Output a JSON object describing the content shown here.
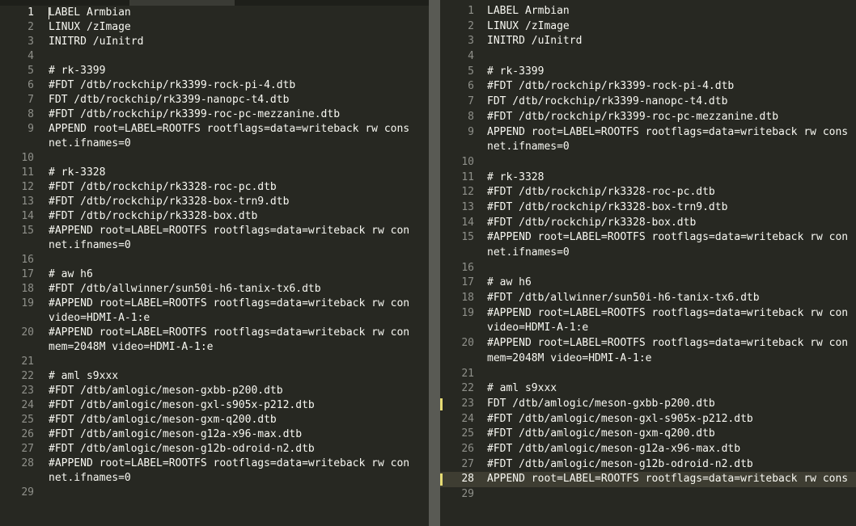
{
  "left_pane": {
    "lines": [
      {
        "num": "1",
        "text": "LABEL Armbian"
      },
      {
        "num": "2",
        "text": "LINUX /zImage"
      },
      {
        "num": "3",
        "text": "INITRD /uInitrd"
      },
      {
        "num": "4",
        "text": ""
      },
      {
        "num": "5",
        "text": "# rk-3399"
      },
      {
        "num": "6",
        "text": "#FDT /dtb/rockchip/rk3399-rock-pi-4.dtb"
      },
      {
        "num": "7",
        "text": "FDT /dtb/rockchip/rk3399-nanopc-t4.dtb"
      },
      {
        "num": "8",
        "text": "#FDT /dtb/rockchip/rk3399-roc-pc-mezzanine.dtb"
      },
      {
        "num": "9",
        "text": "APPEND root=LABEL=ROOTFS rootflags=data=writeback rw cons"
      },
      {
        "num": "",
        "text": "net.ifnames=0"
      },
      {
        "num": "10",
        "text": ""
      },
      {
        "num": "11",
        "text": "# rk-3328"
      },
      {
        "num": "12",
        "text": "#FDT /dtb/rockchip/rk3328-roc-pc.dtb"
      },
      {
        "num": "13",
        "text": "#FDT /dtb/rockchip/rk3328-box-trn9.dtb"
      },
      {
        "num": "14",
        "text": "#FDT /dtb/rockchip/rk3328-box.dtb"
      },
      {
        "num": "15",
        "text": "#APPEND root=LABEL=ROOTFS rootflags=data=writeback rw con"
      },
      {
        "num": "",
        "text": "net.ifnames=0"
      },
      {
        "num": "16",
        "text": ""
      },
      {
        "num": "17",
        "text": "# aw h6"
      },
      {
        "num": "18",
        "text": "#FDT /dtb/allwinner/sun50i-h6-tanix-tx6.dtb"
      },
      {
        "num": "19",
        "text": "#APPEND root=LABEL=ROOTFS rootflags=data=writeback rw con"
      },
      {
        "num": "",
        "text": "video=HDMI-A-1:e"
      },
      {
        "num": "20",
        "text": "#APPEND root=LABEL=ROOTFS rootflags=data=writeback rw con"
      },
      {
        "num": "",
        "text": "mem=2048M video=HDMI-A-1:e"
      },
      {
        "num": "21",
        "text": ""
      },
      {
        "num": "22",
        "text": "# aml s9xxx"
      },
      {
        "num": "23",
        "text": "#FDT /dtb/amlogic/meson-gxbb-p200.dtb"
      },
      {
        "num": "24",
        "text": "#FDT /dtb/amlogic/meson-gxl-s905x-p212.dtb"
      },
      {
        "num": "25",
        "text": "#FDT /dtb/amlogic/meson-gxm-q200.dtb"
      },
      {
        "num": "26",
        "text": "#FDT /dtb/amlogic/meson-g12a-x96-max.dtb"
      },
      {
        "num": "27",
        "text": "#FDT /dtb/amlogic/meson-g12b-odroid-n2.dtb"
      },
      {
        "num": "28",
        "text": "#APPEND root=LABEL=ROOTFS rootflags=data=writeback rw con"
      },
      {
        "num": "",
        "text": "net.ifnames=0"
      },
      {
        "num": "29",
        "text": ""
      }
    ]
  },
  "right_pane": {
    "lines": [
      {
        "num": "1",
        "text": "LABEL Armbian"
      },
      {
        "num": "2",
        "text": "LINUX /zImage"
      },
      {
        "num": "3",
        "text": "INITRD /uInitrd"
      },
      {
        "num": "4",
        "text": ""
      },
      {
        "num": "5",
        "text": "# rk-3399"
      },
      {
        "num": "6",
        "text": "#FDT /dtb/rockchip/rk3399-rock-pi-4.dtb"
      },
      {
        "num": "7",
        "text": "FDT /dtb/rockchip/rk3399-nanopc-t4.dtb"
      },
      {
        "num": "8",
        "text": "#FDT /dtb/rockchip/rk3399-roc-pc-mezzanine.dtb"
      },
      {
        "num": "9",
        "text": "APPEND root=LABEL=ROOTFS rootflags=data=writeback rw cons"
      },
      {
        "num": "",
        "text": "net.ifnames=0"
      },
      {
        "num": "10",
        "text": ""
      },
      {
        "num": "11",
        "text": "# rk-3328"
      },
      {
        "num": "12",
        "text": "#FDT /dtb/rockchip/rk3328-roc-pc.dtb"
      },
      {
        "num": "13",
        "text": "#FDT /dtb/rockchip/rk3328-box-trn9.dtb"
      },
      {
        "num": "14",
        "text": "#FDT /dtb/rockchip/rk3328-box.dtb"
      },
      {
        "num": "15",
        "text": "#APPEND root=LABEL=ROOTFS rootflags=data=writeback rw con"
      },
      {
        "num": "",
        "text": "net.ifnames=0"
      },
      {
        "num": "16",
        "text": ""
      },
      {
        "num": "17",
        "text": "# aw h6"
      },
      {
        "num": "18",
        "text": "#FDT /dtb/allwinner/sun50i-h6-tanix-tx6.dtb"
      },
      {
        "num": "19",
        "text": "#APPEND root=LABEL=ROOTFS rootflags=data=writeback rw con"
      },
      {
        "num": "",
        "text": "video=HDMI-A-1:e"
      },
      {
        "num": "20",
        "text": "#APPEND root=LABEL=ROOTFS rootflags=data=writeback rw con"
      },
      {
        "num": "",
        "text": "mem=2048M video=HDMI-A-1:e"
      },
      {
        "num": "21",
        "text": ""
      },
      {
        "num": "22",
        "text": "# aml s9xxx"
      },
      {
        "num": "23",
        "text": "FDT /dtb/amlogic/meson-gxbb-p200.dtb"
      },
      {
        "num": "24",
        "text": "#FDT /dtb/amlogic/meson-gxl-s905x-p212.dtb"
      },
      {
        "num": "25",
        "text": "#FDT /dtb/amlogic/meson-gxm-q200.dtb"
      },
      {
        "num": "26",
        "text": "#FDT /dtb/amlogic/meson-g12a-x96-max.dtb"
      },
      {
        "num": "27",
        "text": "#FDT /dtb/amlogic/meson-g12b-odroid-n2.dtb"
      },
      {
        "num": "28",
        "text": "APPEND root=LABEL=ROOTFS rootflags=data=writeback rw cons"
      },
      {
        "num": "29",
        "text": ""
      }
    ]
  },
  "colors": {
    "background": "#272822",
    "text": "#f8f8f2",
    "gutter": "#8f908a",
    "splitter": "#595a54",
    "modified_marker": "#e6db74",
    "active_line": "#3e3d32"
  }
}
